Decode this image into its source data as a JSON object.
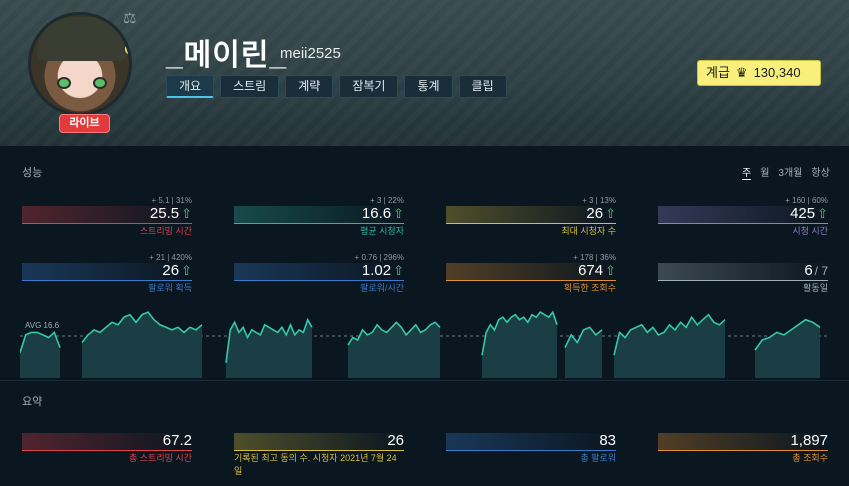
{
  "header": {
    "channel_name": "_메이린_",
    "channel_id": "meii2525",
    "live_badge": "라이브",
    "scale_icon": "scale-icon",
    "tabs": [
      {
        "label": "개요",
        "active": true
      },
      {
        "label": "스트림",
        "active": false
      },
      {
        "label": "계략",
        "active": false
      },
      {
        "label": "잠복기",
        "active": false
      },
      {
        "label": "통계",
        "active": false
      },
      {
        "label": "클립",
        "active": false
      }
    ],
    "rank_label": "계급",
    "rank_value": "130,340",
    "rank_icon": "crown-icon"
  },
  "performance": {
    "title": "성능",
    "periods": [
      {
        "label": "주",
        "active": true
      },
      {
        "label": "월",
        "active": false
      },
      {
        "label": "3개월",
        "active": false
      },
      {
        "label": "항상",
        "active": false
      }
    ],
    "stats": [
      {
        "sub": "+ 5.1 | 31%",
        "value": "25.5",
        "label": "스트리밍 시간",
        "color": "#e0404a",
        "trend": "up"
      },
      {
        "sub": "+ 3 | 22%",
        "value": "16.6",
        "label": "평균 시청자",
        "color": "#2fb8a0",
        "trend": "up"
      },
      {
        "sub": "+ 3 | 13%",
        "value": "26",
        "label": "최대 시청자 수",
        "color": "#d8c040",
        "trend": "up"
      },
      {
        "sub": "+ 160 | 60%",
        "value": "425",
        "label": "시청 시간",
        "color": "#8c80c8",
        "trend": "up"
      },
      {
        "sub": "+ 21 | 420%",
        "value": "26",
        "label": "팔로워 획득",
        "color": "#3a7ac8",
        "trend": "up"
      },
      {
        "sub": "+ 0.76 | 296%",
        "value": "1.02",
        "label": "팔로워/시간",
        "color": "#3a7ac8",
        "trend": "up"
      },
      {
        "sub": "+ 178 | 36%",
        "value": "674",
        "label": "획득한 조회수",
        "color": "#e09030",
        "trend": "up"
      },
      {
        "sub": "",
        "value": "6",
        "value_suffix": "/ 7",
        "label": "활동일",
        "color": "#9fb0b8",
        "trend": "none"
      }
    ],
    "avg_label": "AVG 16.6"
  },
  "summary": {
    "title": "요약",
    "stats": [
      {
        "value": "67.2",
        "label": "총 스트리밍 시간",
        "color": "#e0404a"
      },
      {
        "value": "26",
        "label": "기록된 최고 동의 수. 시청자 2021년 7월 24일",
        "color": "#d8c040"
      },
      {
        "value": "83",
        "label": "총 팔로워",
        "color": "#3a7ac8"
      },
      {
        "value": "1,897",
        "label": "총 조회수",
        "color": "#e09030"
      }
    ]
  },
  "chart_data": {
    "type": "area",
    "avg": 16.6,
    "color": "#36c8a8",
    "segments": [
      [
        10,
        17,
        18,
        18,
        17,
        16,
        18,
        12
      ],
      [
        14,
        17,
        19,
        18,
        20,
        22,
        21,
        24,
        25,
        22,
        25,
        26,
        23,
        21,
        20,
        19,
        20,
        18,
        20,
        19,
        21
      ],
      [
        6,
        19,
        22,
        18,
        20,
        16,
        19,
        18,
        17,
        21,
        20,
        19,
        18,
        20,
        17,
        21,
        17,
        19,
        18,
        23,
        20
      ],
      [
        13,
        16,
        15,
        19,
        17,
        18,
        21,
        19,
        18,
        20,
        22,
        20,
        17,
        19,
        21,
        18,
        19,
        21,
        22,
        20
      ],
      [
        9,
        18,
        21,
        19,
        23,
        24,
        22,
        24,
        25,
        23,
        24,
        22,
        25,
        24,
        26,
        25,
        24,
        26,
        21
      ],
      [
        12,
        17,
        14,
        19,
        20,
        17,
        19
      ],
      [
        9,
        18,
        16,
        19,
        20,
        21,
        18,
        20,
        17,
        18,
        21,
        19,
        22,
        20,
        24,
        21,
        23,
        25,
        22,
        21,
        23
      ],
      [
        11,
        15,
        16,
        18,
        17,
        19,
        21,
        23,
        22,
        20
      ]
    ],
    "segment_spans": [
      [
        0,
        40
      ],
      [
        62,
        182
      ],
      [
        206,
        292
      ],
      [
        328,
        420
      ],
      [
        462,
        537
      ],
      [
        545,
        582
      ],
      [
        594,
        705
      ],
      [
        735,
        800
      ]
    ],
    "ymax": 30
  }
}
